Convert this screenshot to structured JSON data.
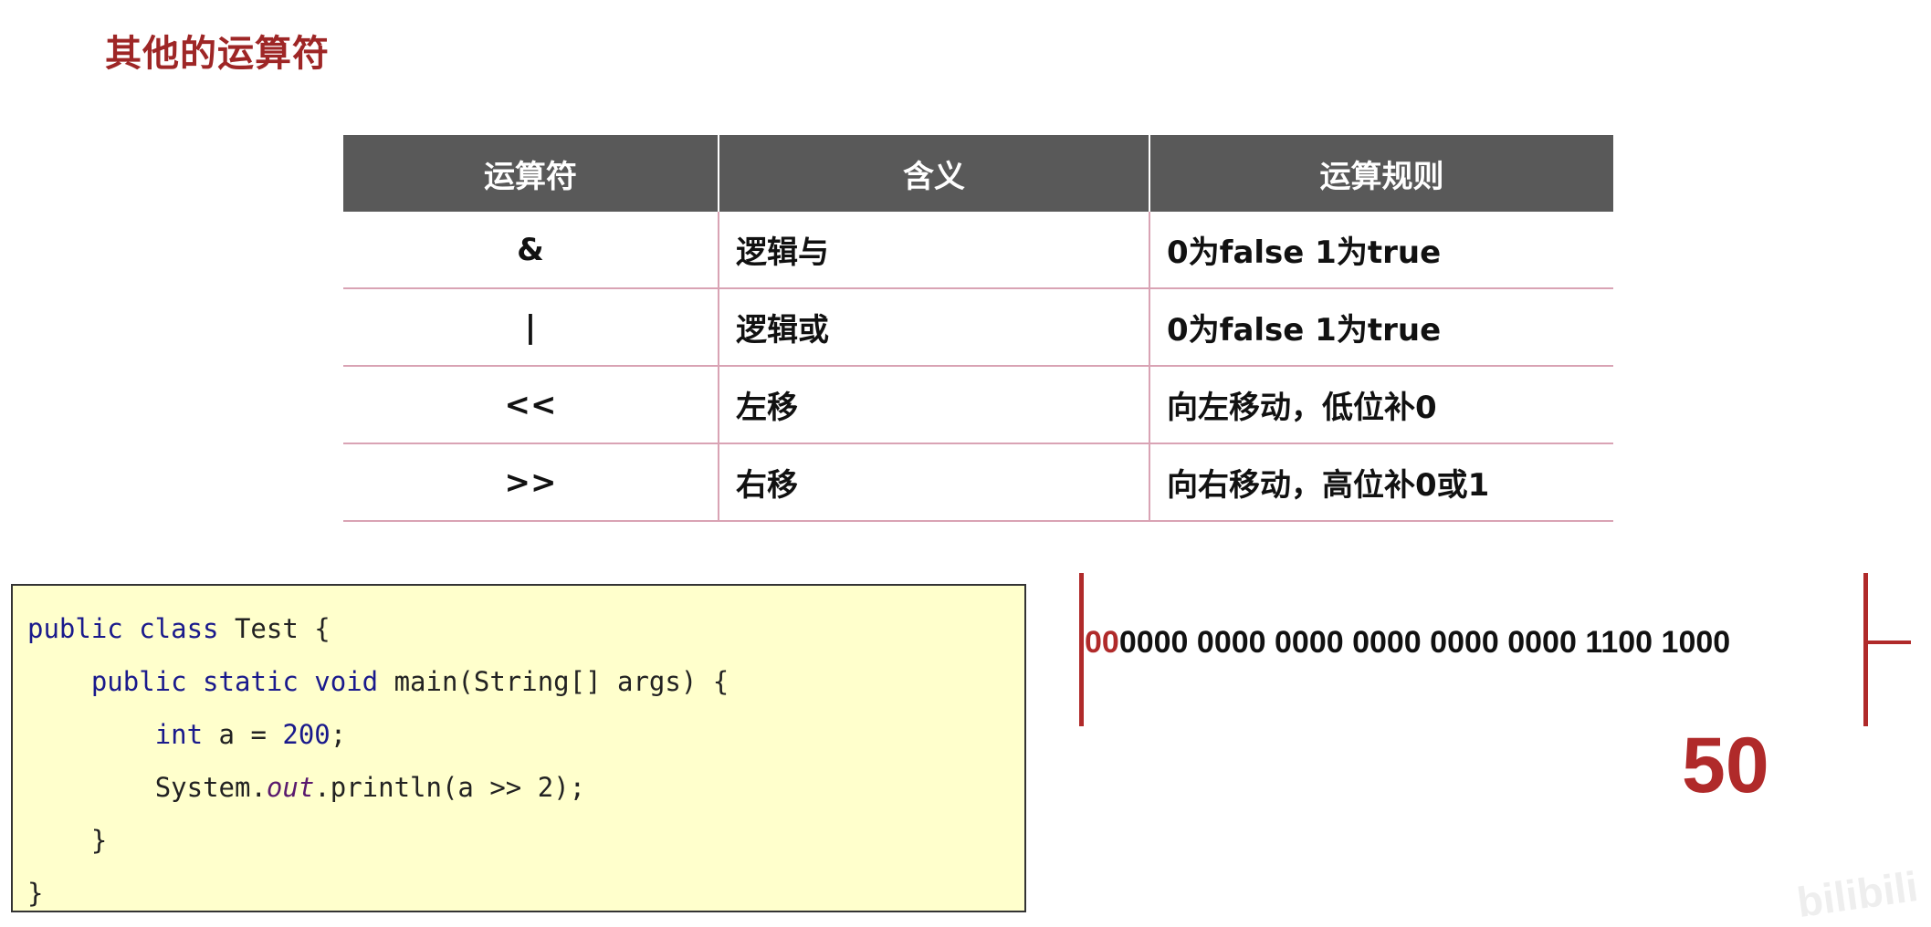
{
  "page": {
    "title": "其他的运算符"
  },
  "table": {
    "headers": [
      "运算符",
      "含义",
      "运算规则"
    ],
    "rows": [
      {
        "op": "&",
        "meaning": "逻辑与",
        "rule": "0为false 1为true"
      },
      {
        "op": "|",
        "meaning": "逻辑或",
        "rule": "0为false 1为true"
      },
      {
        "op": "<<",
        "meaning": "左移",
        "rule": "向左移动，低位补0"
      },
      {
        "op": ">>",
        "meaning": "右移",
        "rule": "向右移动，高位补0或1"
      }
    ]
  },
  "code": {
    "l1_kw": "public class",
    "l1_rest": " Test {",
    "l2_kw": "public static void",
    "l2_rest": " main(String[] args) {",
    "l3_kw": "int",
    "l3_mid": " a = ",
    "l3_num": "200",
    "l3_end": ";",
    "l4_pre": "System.",
    "l4_it": "out",
    "l4_rest": ".println(a >> 2);",
    "l5": "}",
    "l6": "}"
  },
  "binary": {
    "prefix": "00",
    "value": "0000 0000 0000 0000 0000 0000 1100 1000"
  },
  "result": {
    "value": "50"
  },
  "watermark": {
    "text": "bilibili"
  },
  "colors": {
    "accent_red": "#b02a2a",
    "header_gray": "#595959",
    "code_bg": "#ffffcc"
  }
}
